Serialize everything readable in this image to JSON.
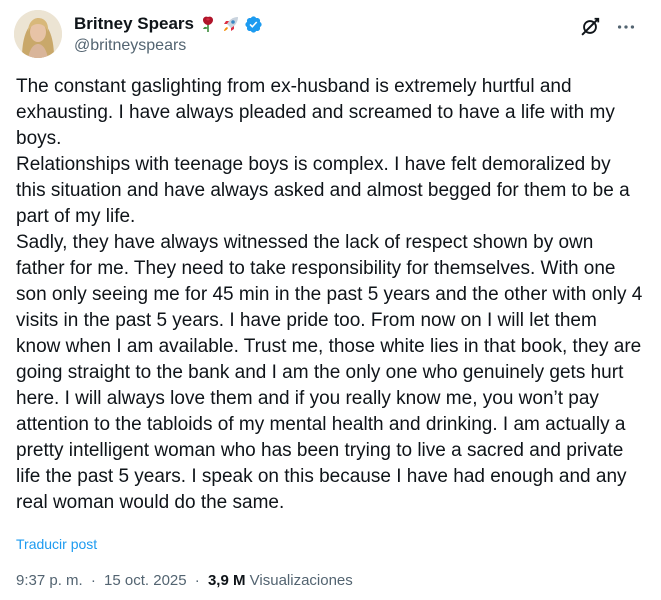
{
  "author": {
    "display_name": "Britney Spears",
    "handle": "@britneyspears",
    "emojis": [
      "rose",
      "rocket"
    ],
    "verified": true,
    "verified_color": "#1d9bf0"
  },
  "tweet": {
    "paragraphs": [
      "The constant gaslighting from ex-husband is extremely hurtful and exhausting. I have always pleaded and screamed to have a life with my boys.",
      "Relationships with teenage boys is complex. I have felt demoralized by this situation and have always asked and almost begged for them to be a part of my life.",
      "Sadly, they have always witnessed the lack of respect shown by own father for me. They need to take responsibility for themselves. With one son only seeing me for 45 min in the past 5 years and the other with only 4 visits in the past 5 years. I have pride too. From now on I will let them know when I am available. Trust me, those white lies in that book, they are going straight to the bank and I am the only one who genuinely gets hurt here. I will always love them and if you really know me, you won’t pay attention to the tabloids of my mental health and drinking. I am actually a pretty intelligent woman who has been trying to live a sacred and private life the past 5 years. I speak on this because I have had enough and any real woman would do the same."
    ],
    "translate_label": "Traducir post"
  },
  "meta": {
    "time": "9:37 p. m.",
    "separator": "·",
    "date": "15 oct. 2025",
    "views_count": "3,9 M",
    "views_label": "Visualizaciones"
  },
  "icons": {
    "grok": "grok-icon",
    "more": "more-icon",
    "verified": "verified-badge-icon"
  },
  "colors": {
    "text": "#0f1419",
    "secondary": "#536471",
    "link": "#1d9bf0"
  }
}
